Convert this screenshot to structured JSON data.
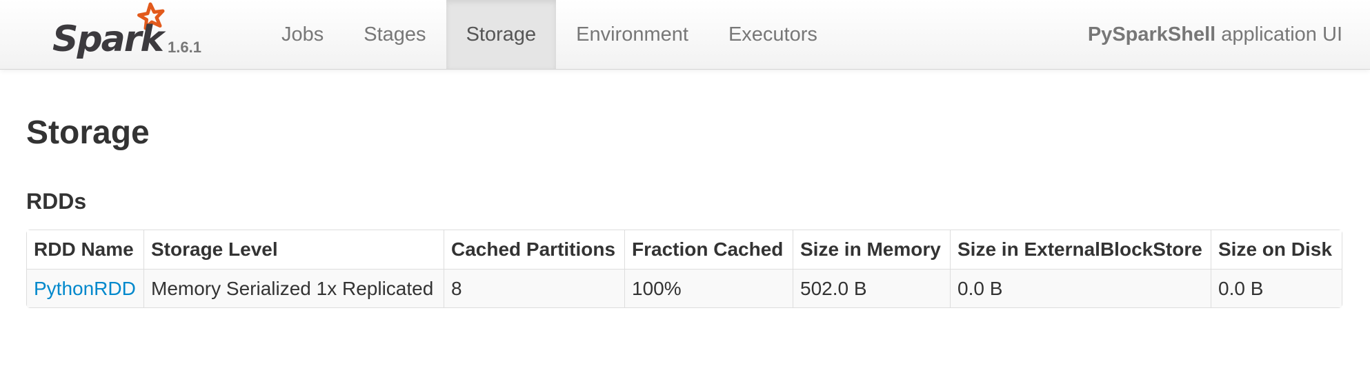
{
  "navbar": {
    "logo_text": "Spark",
    "version": "1.6.1",
    "tabs": [
      {
        "label": "Jobs",
        "active": false
      },
      {
        "label": "Stages",
        "active": false
      },
      {
        "label": "Storage",
        "active": true
      },
      {
        "label": "Environment",
        "active": false
      },
      {
        "label": "Executors",
        "active": false
      }
    ],
    "app_name": "PySparkShell",
    "app_suffix": "application UI"
  },
  "page": {
    "title": "Storage",
    "section_title": "RDDs"
  },
  "table": {
    "columns": [
      "RDD Name",
      "Storage Level",
      "Cached Partitions",
      "Fraction Cached",
      "Size in Memory",
      "Size in ExternalBlockStore",
      "Size on Disk"
    ],
    "rows": [
      [
        "PythonRDD",
        "Memory Serialized 1x Replicated",
        "8",
        "100%",
        "502.0 B",
        "0.0 B",
        "0.0 B"
      ]
    ]
  },
  "colors": {
    "logo_text": "#3c3a3e",
    "logo_star": "#e25a1c",
    "link": "#0088cc",
    "active_tab_bg": "#e5e5e5"
  }
}
